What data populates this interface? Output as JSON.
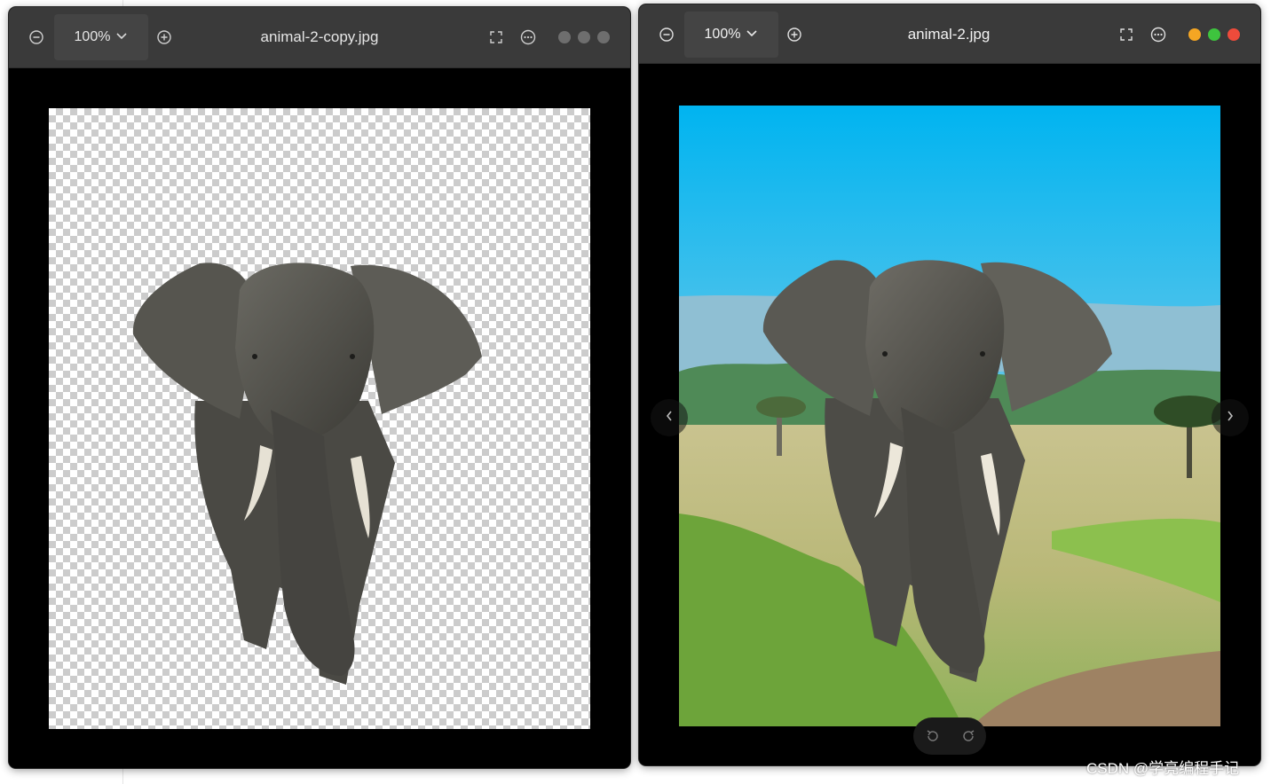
{
  "left_window": {
    "zoom": "100%",
    "title": "animal-2-copy.jpg",
    "traffic_light_colors": [
      "#6e6e6e",
      "#6e6e6e",
      "#6e6e6e"
    ]
  },
  "right_window": {
    "zoom": "100%",
    "title": "animal-2.jpg",
    "traffic_light_colors": [
      "#f5a623",
      "#3ec43e",
      "#ee4b3b"
    ]
  },
  "icons": {
    "zoom_out": "zoom-out-icon",
    "zoom_in": "zoom-in-icon",
    "dropdown": "chevron-down-icon",
    "fullscreen": "fullscreen-icon",
    "more": "more-options-icon",
    "prev": "chevron-left-icon",
    "next": "chevron-right-icon",
    "rotate_left": "rotate-left-icon",
    "rotate_right": "rotate-right-icon"
  },
  "watermark": "CSDN @学亮编程手记"
}
